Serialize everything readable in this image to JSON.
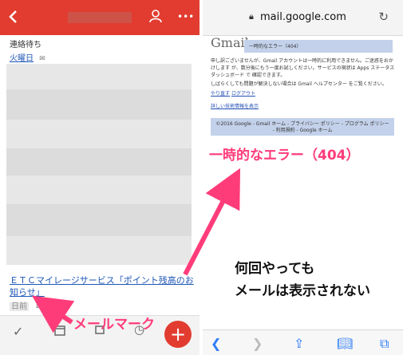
{
  "left_app": {
    "header": {
      "person_icon": "person-icon",
      "more_icon": "more-dots-icon",
      "more_label": "•••"
    },
    "email": {
      "header_line": "連絡待ち",
      "date_label": "火曜日",
      "subject": "ＥＴＣマイレージサービス「ポイント残高のお知らせ」",
      "date_label_2": "日前"
    },
    "bottom": {
      "check_icon": "check-icon",
      "fab_label": "+"
    }
  },
  "right_app": {
    "safari": {
      "url": "mail.google.com"
    },
    "gmail_page": {
      "logo": "Gmail",
      "error_box_title": "一時的なエラー（404）",
      "p1": "申し訳ございませんが、Gmail アカウントは一時的に利用できません。ご迷惑をおかけします が、数分後にもう一度お試しください。サービスの現状は Apps ステータス ダッシュボード で 確認できます。",
      "p2": "しばらくしても問題が解決しない場合は Gmail ヘルプセンター をご覧ください。",
      "retry_link": "やり直す",
      "logout_link": "ログアウト",
      "detail_link": "詳しい技術情報を表示",
      "footer": "©2016 Google - Gmail ホーム - プライバシー ポリシー - プログラム ポリシー - 利用規約 - Google ホーム"
    }
  },
  "annotations": {
    "error_caption": "一時的なエラー（404）",
    "mark_caption": "メールマーク",
    "note_line1": "何回やっても",
    "note_line2": "メールは表示されない"
  },
  "colors": {
    "gmail_red": "#e23c30",
    "annotation_pink": "#ff3c7a",
    "link_blue": "#1e57b6",
    "error_box": "#c3d1ea"
  }
}
